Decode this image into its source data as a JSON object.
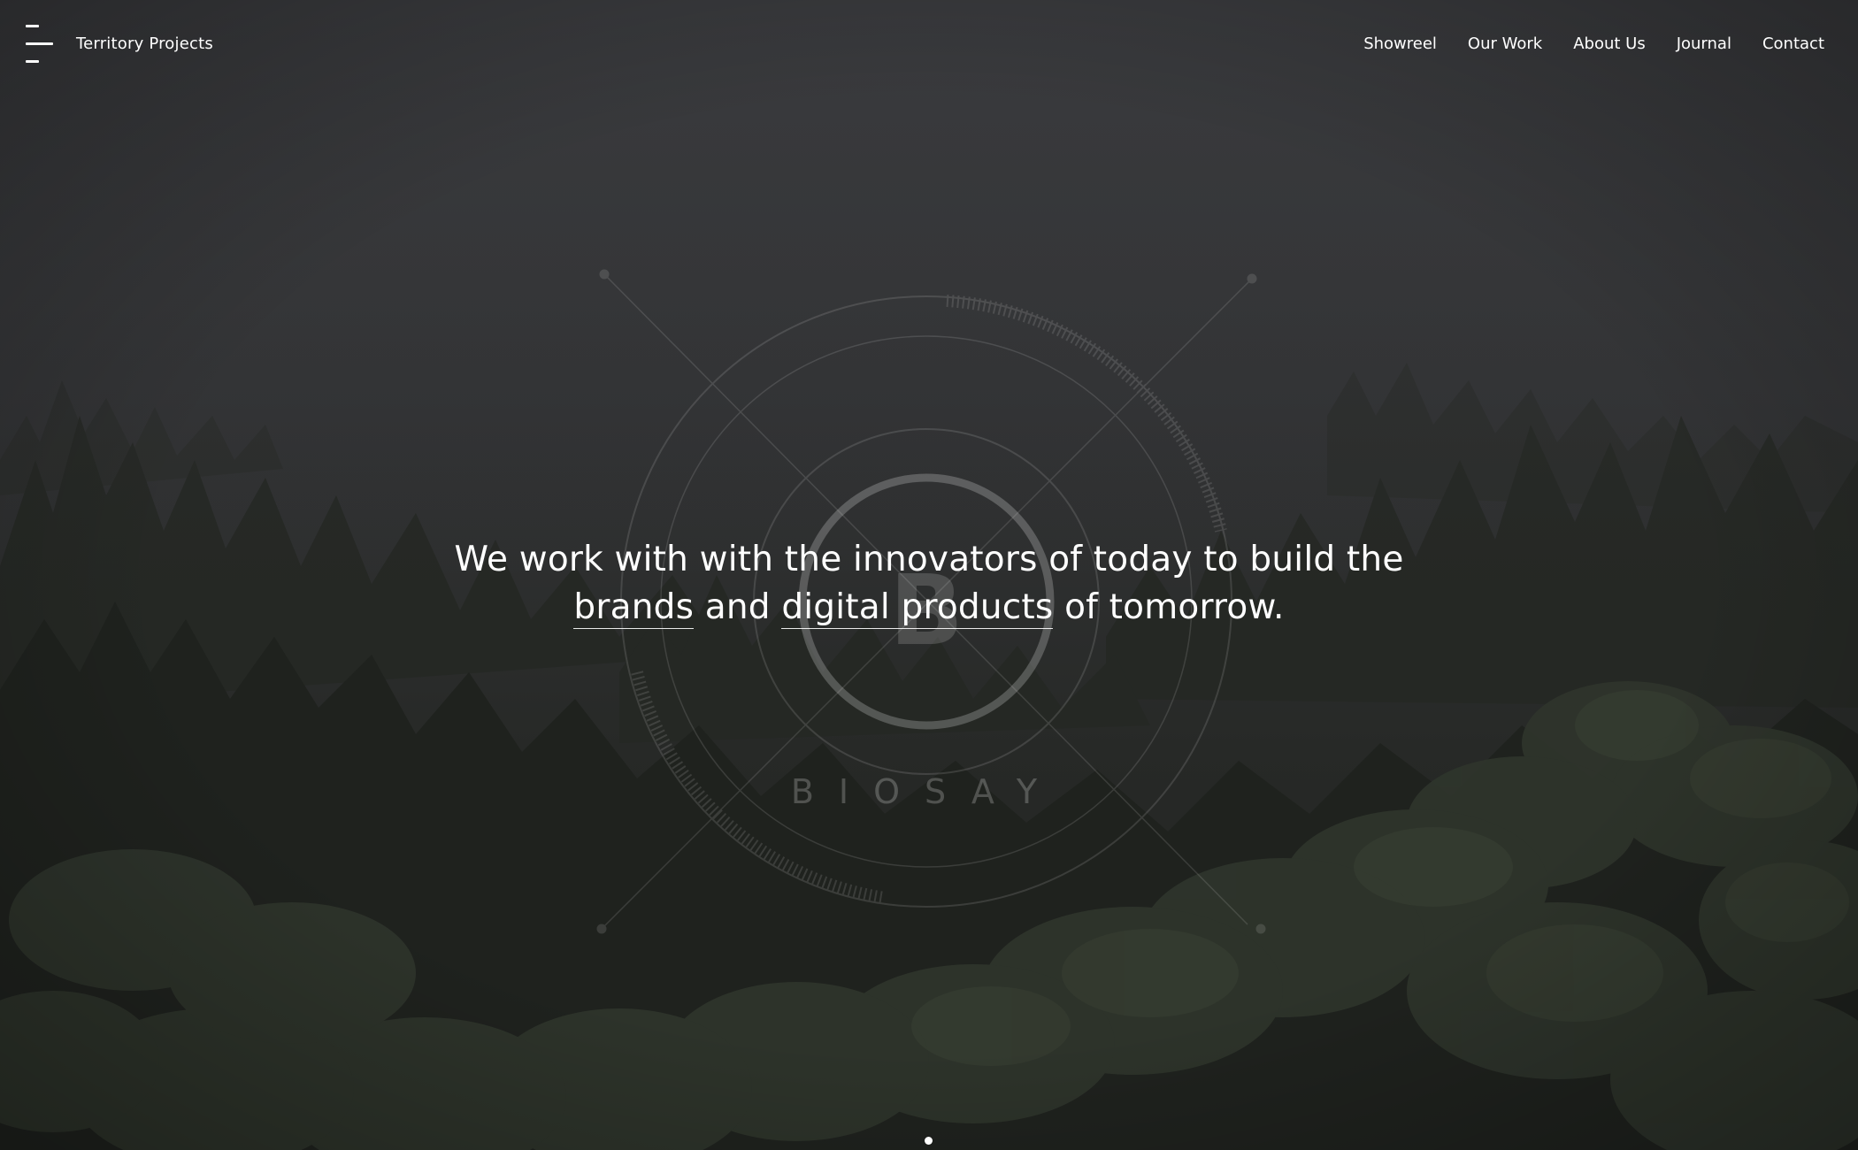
{
  "header": {
    "brand": "Territory Projects",
    "nav": [
      "Showreel",
      "Our Work",
      "About Us",
      "Journal",
      "Contact"
    ]
  },
  "hero": {
    "headline_line1": "We work with with the innovators of today to build the",
    "link_brands": "brands",
    "text_and": "and",
    "link_digital_products": "digital products",
    "text_tail": "of tomorrow.",
    "watermark_monogram": "B",
    "watermark_wordmark": "BIOSAY"
  },
  "pagination": {
    "active": 1,
    "total": 1
  },
  "colors": {
    "sky": "#393a3d",
    "forest_dark": "#1e211d",
    "text": "#ffffff"
  }
}
